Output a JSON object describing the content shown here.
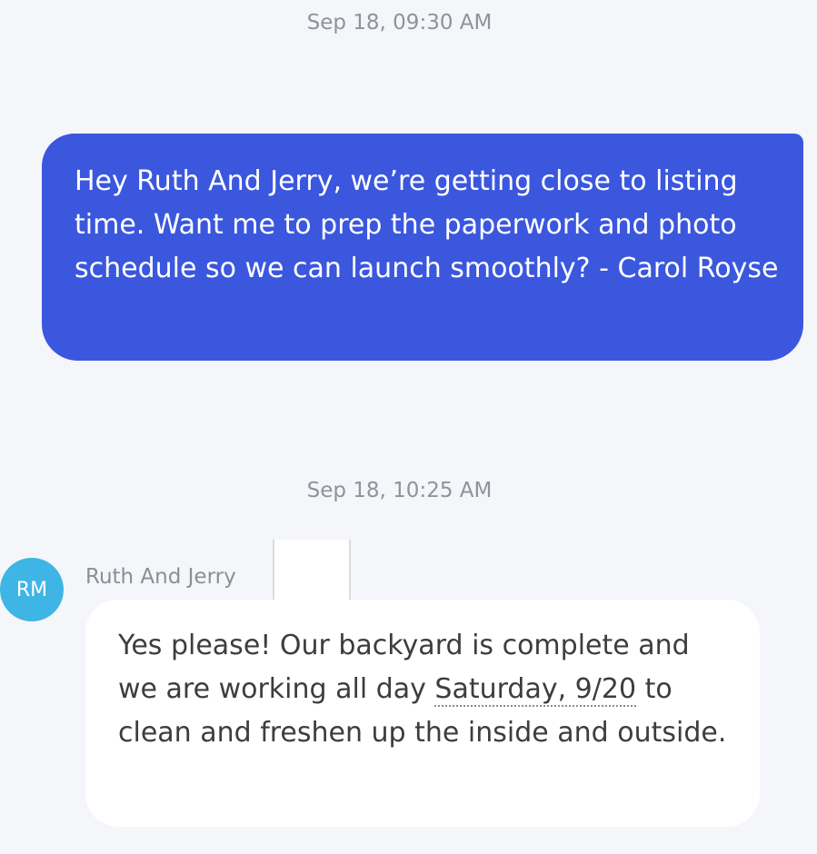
{
  "thread": {
    "messages": [
      {
        "timestamp": "Sep 18, 09:30 AM",
        "direction": "outgoing",
        "text": "Hey Ruth And Jerry, we’re getting close to listing time. Want me to prep the paperwork and photo schedule so we can launch smoothly? - Carol Royse"
      },
      {
        "timestamp": "Sep 18, 10:25 AM",
        "direction": "incoming",
        "sender_name": "Ruth And Jerry",
        "avatar_initials": "RM",
        "text_before": "Yes please! Our backyard is complete and we are working all day ",
        "date_link": "Saturday, 9/20",
        "text_after": " to clean and freshen up the inside and outside."
      }
    ]
  },
  "colors": {
    "background": "#f5f6fa",
    "outgoing_bubble": "#3b57de",
    "incoming_bubble": "#ffffff",
    "avatar": "#3fb5e6",
    "timestamp_text": "#8e939c"
  }
}
